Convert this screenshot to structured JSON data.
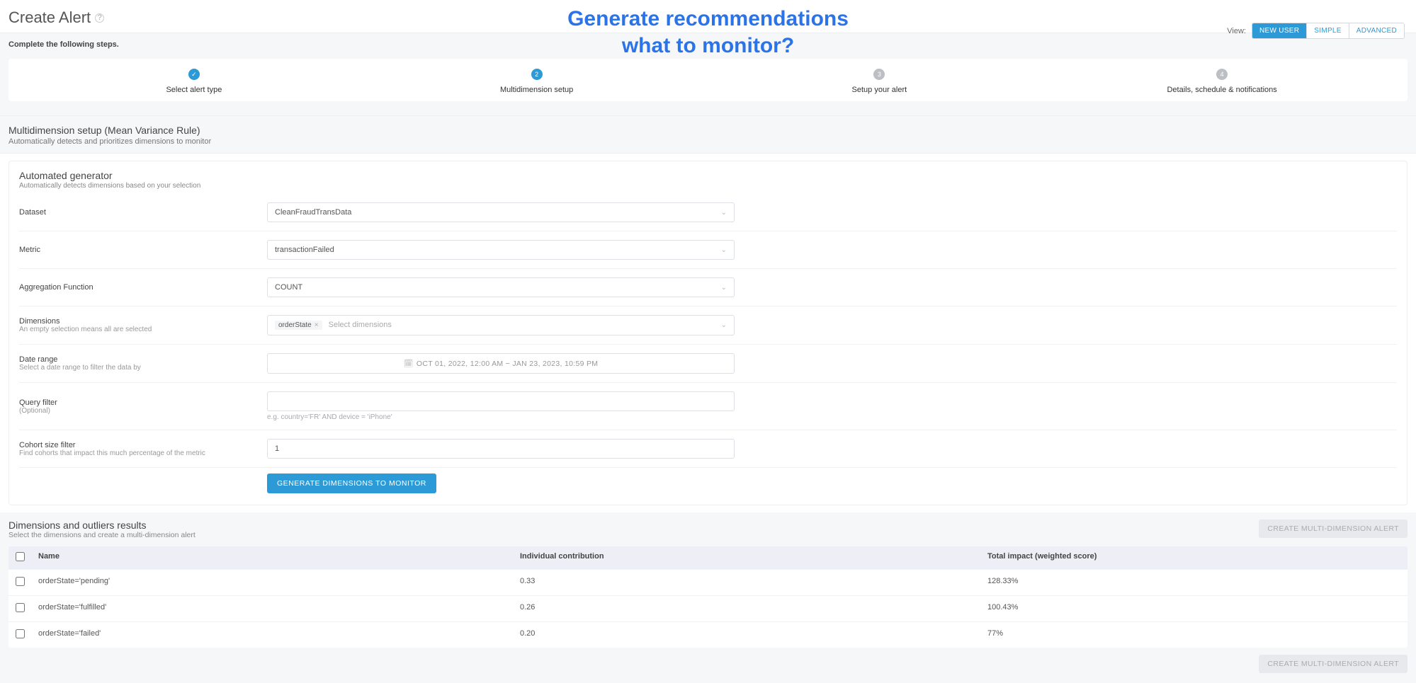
{
  "header": {
    "title": "Create Alert",
    "banner": "Generate recommendations\nwhat to monitor?",
    "view_label": "View:",
    "view_options": [
      "NEW USER",
      "SIMPLE",
      "ADVANCED"
    ],
    "view_active": "NEW USER"
  },
  "stepper": {
    "instruction": "Complete the following steps.",
    "steps": [
      {
        "label": "Select alert type",
        "state": "done"
      },
      {
        "label": "Multidimension setup",
        "state": "active",
        "num": "2"
      },
      {
        "label": "Setup your alert",
        "state": "todo",
        "num": "3"
      },
      {
        "label": "Details, schedule & notifications",
        "state": "todo",
        "num": "4"
      }
    ]
  },
  "section": {
    "title": "Multidimension setup (Mean Variance Rule)",
    "subtitle": "Automatically detects and prioritizes dimensions to monitor"
  },
  "generator": {
    "title": "Automated generator",
    "subtitle": "Automatically detects dimensions based on your selection",
    "fields": {
      "dataset": {
        "label": "Dataset",
        "value": "CleanFraudTransData"
      },
      "metric": {
        "label": "Metric",
        "value": "transactionFailed"
      },
      "aggfn": {
        "label": "Aggregation Function",
        "value": "COUNT"
      },
      "dims": {
        "label": "Dimensions",
        "hint": "An empty selection means all are selected",
        "chip": "orderState",
        "placeholder": "Select dimensions"
      },
      "daterange": {
        "label": "Date range",
        "hint": "Select a date range to filter the data by",
        "value": "OCT 01, 2022, 12:00 AM − JAN 23, 2023, 10:59 PM"
      },
      "query": {
        "label": "Query filter",
        "hint": "(Optional)",
        "placeholder_hint": "e.g. country='FR' AND device = 'iPhone'"
      },
      "cohort": {
        "label": "Cohort size filter",
        "hint": "Find cohorts that impact this much percentage of the metric",
        "value": "1"
      }
    },
    "generate_button": "GENERATE DIMENSIONS TO MONITOR"
  },
  "results": {
    "title": "Dimensions and outliers results",
    "subtitle": "Select the dimensions and create a multi-dimension alert",
    "create_button": "CREATE MULTI-DIMENSION ALERT",
    "columns": {
      "name": "Name",
      "contrib": "Individual contribution",
      "impact": "Total impact (weighted score)"
    },
    "rows": [
      {
        "name": "orderState='pending'",
        "contrib": "0.33",
        "impact": "128.33%"
      },
      {
        "name": "orderState='fulfilled'",
        "contrib": "0.26",
        "impact": "100.43%"
      },
      {
        "name": "orderState='failed'",
        "contrib": "0.20",
        "impact": "77%"
      }
    ]
  }
}
